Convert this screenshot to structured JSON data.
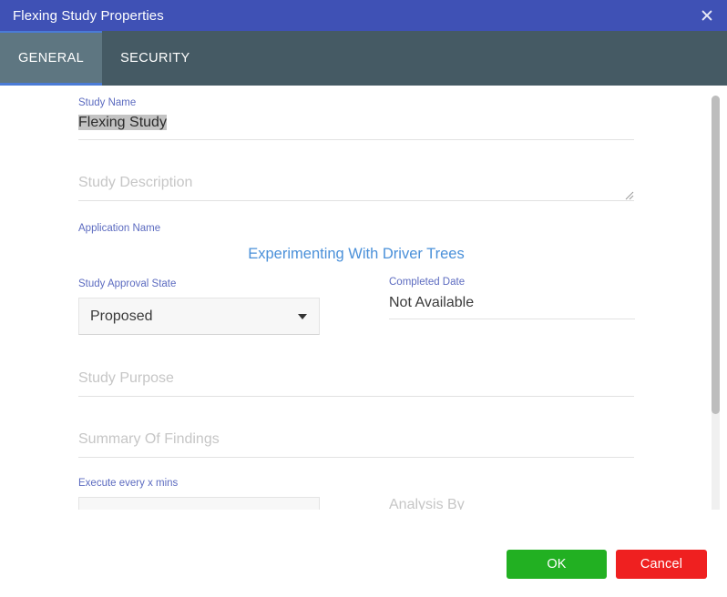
{
  "window": {
    "title": "Flexing Study Properties",
    "close_icon": "close-icon",
    "titlebar_color": "#3f51b5",
    "tabbar_color": "#455a64",
    "accent_color": "#5c6bc0"
  },
  "tabs": [
    {
      "label": "GENERAL",
      "active": true
    },
    {
      "label": "SECURITY",
      "active": false
    }
  ],
  "form": {
    "study_name": {
      "label": "Study Name",
      "value": "Flexing Study",
      "selected": true
    },
    "study_description": {
      "label": "",
      "placeholder": "Study Description",
      "value": "",
      "resize_grip_icon": "resize-grip-icon"
    },
    "application_name": {
      "label": "Application Name",
      "value": "Experimenting With Driver Trees",
      "link_color": "#4a90d9"
    },
    "study_approval_state": {
      "label": "Study Approval State",
      "value": "Proposed",
      "caret_icon": "chevron-down-icon"
    },
    "completed_date": {
      "label": "Completed Date",
      "value": "Not Available"
    },
    "study_purpose": {
      "label": "",
      "placeholder": "Study Purpose",
      "value": ""
    },
    "summary_of_findings": {
      "label": "",
      "placeholder": "Summary Of Findings",
      "value": ""
    },
    "execute_every_x_mins": {
      "label": "Execute every x mins",
      "value": "",
      "caret_icon": "chevron-down-icon"
    },
    "analysis_by": {
      "label": "",
      "placeholder": "Analysis By",
      "value": ""
    }
  },
  "scrollbar": {
    "name": "vertical-scrollbar",
    "thumb_color": "#bdbdbd",
    "track_color": "#f0f0f0"
  },
  "footer": {
    "ok_label": "OK",
    "cancel_label": "Cancel",
    "ok_color": "#22b022",
    "cancel_color": "#ef2020"
  }
}
